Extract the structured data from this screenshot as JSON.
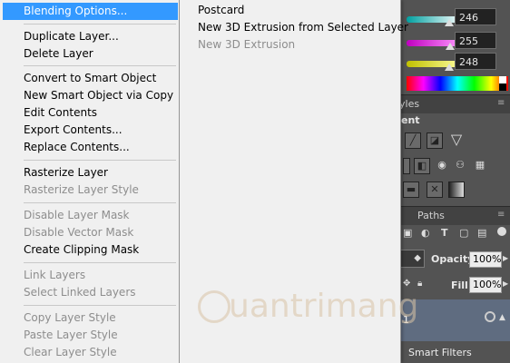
{
  "context_menu": {
    "items": [
      {
        "label": "Blending Options...",
        "enabled": true,
        "highlighted": true
      },
      {
        "label": "Duplicate Layer...",
        "enabled": true
      },
      {
        "label": "Delete Layer",
        "enabled": true
      },
      {
        "label": "Convert to Smart Object",
        "enabled": true
      },
      {
        "label": "New Smart Object via Copy",
        "enabled": true
      },
      {
        "label": "Edit Contents",
        "enabled": true
      },
      {
        "label": "Export Contents...",
        "enabled": true
      },
      {
        "label": "Replace Contents...",
        "enabled": true
      },
      {
        "label": "Rasterize Layer",
        "enabled": true
      },
      {
        "label": "Rasterize Layer Style",
        "enabled": false
      },
      {
        "label": "Disable Layer Mask",
        "enabled": false
      },
      {
        "label": "Disable Vector Mask",
        "enabled": false
      },
      {
        "label": "Create Clipping Mask",
        "enabled": true
      },
      {
        "label": "Link Layers",
        "enabled": false
      },
      {
        "label": "Select Linked Layers",
        "enabled": false
      },
      {
        "label": "Copy Layer Style",
        "enabled": false
      },
      {
        "label": "Paste Layer Style",
        "enabled": false
      },
      {
        "label": "Clear Layer Style",
        "enabled": false
      }
    ]
  },
  "submenu": {
    "items": [
      {
        "label": "Postcard",
        "enabled": true
      },
      {
        "label": "New 3D Extrusion from Selected Layer",
        "enabled": true
      },
      {
        "label": "New 3D Extrusion",
        "enabled": false
      }
    ]
  },
  "color_panel": {
    "values": [
      "246",
      "255",
      "248"
    ],
    "slider_levels_percent": [
      96,
      100,
      97
    ]
  },
  "panels": {
    "styles_tab": "yles",
    "adjustments_title": "ent",
    "paths_tab": "Paths",
    "opacity_label": "Opacity:",
    "opacity_value": "100%",
    "fill_label": "Fill:",
    "fill_value": "100%",
    "layer_suffix": "1",
    "smart_filters": "Smart Filters"
  },
  "watermark": {
    "text": "uantrimang"
  },
  "colors": {
    "menu_bg": "#f0f0f0",
    "highlight": "#3399ff",
    "disabled_text": "#8d8d8d",
    "panel_bg": "#535353"
  }
}
